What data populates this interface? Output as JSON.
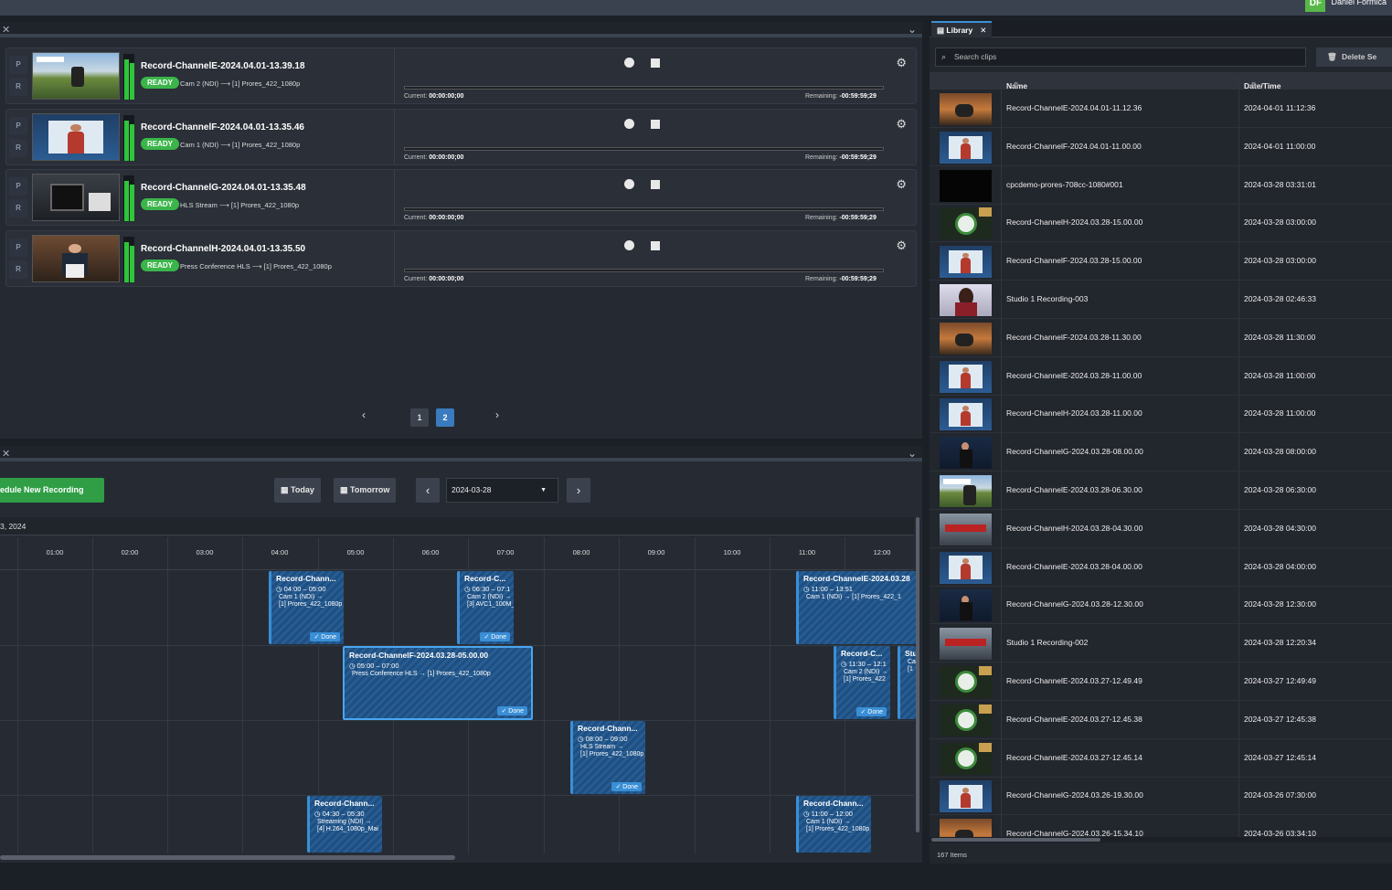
{
  "user": {
    "initials": "DF",
    "name": "Daniel Formica"
  },
  "channels": [
    {
      "title": "Record-ChannelE-2024.04.01-13.39.18",
      "status": "READY",
      "source": "Cam 2 (NDI)",
      "arrow": "⟶",
      "output": "[1] Prores_422_1080p",
      "current_label": "Current:",
      "current": "00:00:00;00",
      "remaining_label": "Remaining:",
      "remaining": "-00:59:59;29",
      "thumb": "bike"
    },
    {
      "title": "Record-ChannelF-2024.04.01-13.35.46",
      "status": "READY",
      "source": "Cam 1 (NDI)",
      "arrow": "⟶",
      "output": "[1] Prores_422_1080p",
      "current_label": "Current:",
      "current": "00:00:00;00",
      "remaining_label": "Remaining:",
      "remaining": "-00:59:59;29",
      "thumb": "presenter"
    },
    {
      "title": "Record-ChannelG-2024.04.01-13.35.48",
      "status": "READY",
      "source": "HLS Stream",
      "arrow": "⟶",
      "output": "[1] Prores_422_1080p",
      "current_label": "Current:",
      "current": "00:00:00;00",
      "remaining_label": "Remaining:",
      "remaining": "-00:59:59;29",
      "thumb": "machine"
    },
    {
      "title": "Record-ChannelH-2024.04.01-13.35.50",
      "status": "READY",
      "source": "Press Conference HLS",
      "arrow": "⟶",
      "output": "[1] Prores_422_1080p",
      "current_label": "Current:",
      "current": "00:00:00;00",
      "remaining_label": "Remaining:",
      "remaining": "-00:59:59;29",
      "thumb": "podium"
    }
  ],
  "pr": {
    "p": "P",
    "r": "R"
  },
  "pager": {
    "prev": "‹",
    "next": "›",
    "pages": [
      "1",
      "2"
    ],
    "active": "2"
  },
  "schedule": {
    "new_btn": "edule New Recording",
    "today": "Today",
    "tomorrow": "Tomorrow",
    "date": "2024-03-28",
    "date_heading": "3, 2024",
    "hours": [
      "01:00",
      "02:00",
      "03:00",
      "04:00",
      "05:00",
      "06:00",
      "07:00",
      "08:00",
      "09:00",
      "10:00",
      "11:00",
      "12:00"
    ],
    "events": [
      {
        "title": "Record-Chann...",
        "time": "04:00 – 05:00",
        "src": "Cam 1 (NDI)  →",
        "out": "[1] Prores_422_1080p",
        "done": "✓ Done"
      },
      {
        "title": "Record-C...",
        "time": "06:30 – 07:1",
        "src": "Cam 2 (NDI)  →",
        "out": "[3] AVC1_100M_",
        "done": "✓ Done"
      },
      {
        "title": "Record-ChannelE-2024.03.28",
        "time": "11:00 – 13:51",
        "src": "Cam 1 (NDI)  →  [1] Prores_422_1",
        "out": "",
        "done": ""
      },
      {
        "title": "Record-ChannelF-2024.03.28-05.00.00",
        "time": "05:00 – 07:00",
        "src": "Press Conference HLS  →  [1] Prores_422_1080p",
        "out": "",
        "done": "✓ Done"
      },
      {
        "title": "Record-C...",
        "time": "11:30 – 12:1",
        "src": "Cam 2 (NDI)  →",
        "out": "[1] Prores_422",
        "done": "✓ Done"
      },
      {
        "title": "Stu",
        "time": "",
        "src": "Ca",
        "out": "[1",
        "done": ""
      },
      {
        "title": "Record-Chann...",
        "time": "08:00 – 09:00",
        "src": "HLS Stream  →",
        "out": "[1] Prores_422_1080p",
        "done": "✓ Done"
      },
      {
        "title": "Record-Chann...",
        "time": "04:30 – 05:30",
        "src": "Streaming (NDI)  →",
        "out": "[4] H.264_1080p_Mai",
        "done": ""
      },
      {
        "title": "Record-Chann...",
        "time": "11:00 – 12:00",
        "src": "Cam 1 (NDI)  →",
        "out": "[1] Prores_422_1080p",
        "done": ""
      }
    ]
  },
  "library": {
    "tab": "Library",
    "search_placeholder": "Search clips",
    "delete": "Delete Se",
    "col_name": "Name",
    "col_date": "Date/Time",
    "count": "167 Items",
    "rows": [
      {
        "name": "Record-ChannelE-2024.04.01-11.12.36",
        "date": "2024-04-01 11:12:36",
        "thumb": "moto"
      },
      {
        "name": "Record-ChannelF-2024.04.01-11.00.00",
        "date": "2024-04-01 11:00:00",
        "thumb": "presenter"
      },
      {
        "name": "cpcdemo-prores-708cc-1080#001",
        "date": "2024-03-28 03:31:01",
        "thumb": "black"
      },
      {
        "name": "Record-ChannelH-2024.03.28-15.00.00",
        "date": "2024-03-28 03:00:00",
        "thumb": "globe"
      },
      {
        "name": "Record-ChannelF-2024.03.28-15.00.00",
        "date": "2024-03-28 03:00:00",
        "thumb": "presenter"
      },
      {
        "name": "Studio 1 Recording-003",
        "date": "2024-03-28 02:46:33",
        "thumb": "woman"
      },
      {
        "name": "Record-ChannelF-2024.03.28-11.30.00",
        "date": "2024-03-28 11:30:00",
        "thumb": "moto"
      },
      {
        "name": "Record-ChannelE-2024.03.28-11.00.00",
        "date": "2024-03-28 11:00:00",
        "thumb": "presenter"
      },
      {
        "name": "Record-ChannelH-2024.03.28-11.00.00",
        "date": "2024-03-28 11:00:00",
        "thumb": "presenter"
      },
      {
        "name": "Record-ChannelG-2024.03.28-08.00.00",
        "date": "2024-03-28 08:00:00",
        "thumb": "speaker"
      },
      {
        "name": "Record-ChannelE-2024.03.28-06.30.00",
        "date": "2024-03-28 06:30:00",
        "thumb": "bike"
      },
      {
        "name": "Record-ChannelH-2024.03.28-04.30.00",
        "date": "2024-03-28 04:30:00",
        "thumb": "street"
      },
      {
        "name": "Record-ChannelE-2024.03.28-04.00.00",
        "date": "2024-03-28 04:00:00",
        "thumb": "presenter"
      },
      {
        "name": "Record-ChannelG-2024.03.28-12.30.00",
        "date": "2024-03-28 12:30:00",
        "thumb": "speaker"
      },
      {
        "name": "Studio 1 Recording-002",
        "date": "2024-03-28 12:20:34",
        "thumb": "street"
      },
      {
        "name": "Record-ChannelE-2024.03.27-12.49.49",
        "date": "2024-03-27 12:49:49",
        "thumb": "globe"
      },
      {
        "name": "Record-ChannelE-2024.03.27-12.45.38",
        "date": "2024-03-27 12:45:38",
        "thumb": "globe"
      },
      {
        "name": "Record-ChannelE-2024.03.27-12.45.14",
        "date": "2024-03-27 12:45:14",
        "thumb": "globe"
      },
      {
        "name": "Record-ChannelG-2024.03.26-19.30.00",
        "date": "2024-03-26 07:30:00",
        "thumb": "presenter"
      },
      {
        "name": "Record-ChannelG-2024.03.26-15.34.10",
        "date": "2024-03-26 03:34:10",
        "thumb": "moto"
      }
    ]
  },
  "colors": {
    "accent": "#3a8fd6",
    "ready": "#3bb54a",
    "schedule_btn": "#2f9e45"
  }
}
